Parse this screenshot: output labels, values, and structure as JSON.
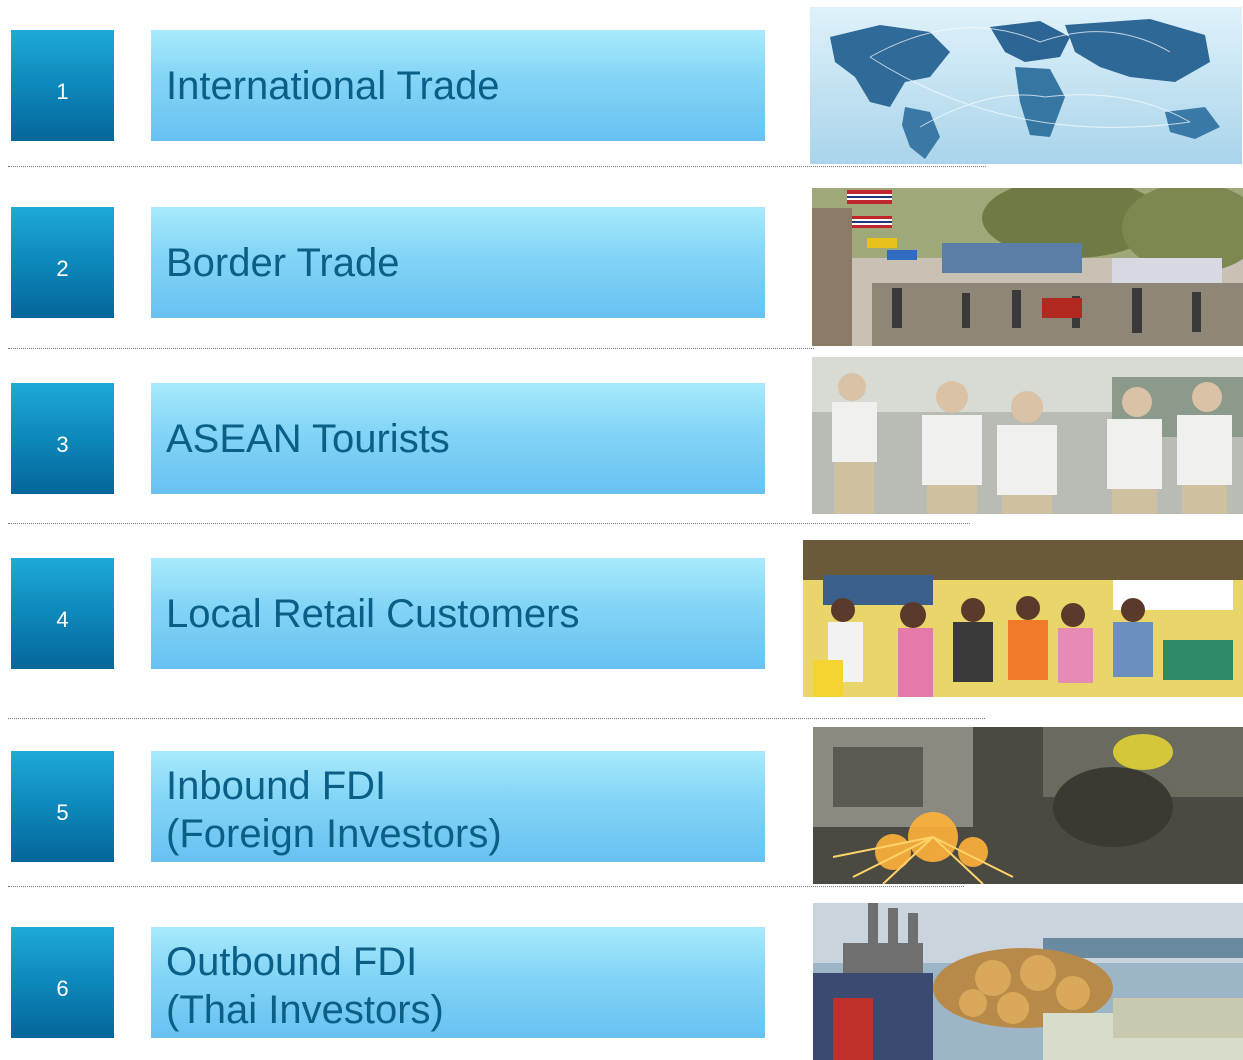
{
  "items": [
    {
      "number": "1",
      "label": "International Trade",
      "image": "world-map-network-photo"
    },
    {
      "number": "2",
      "label": "Border Trade",
      "image": "border-checkpoint-photo"
    },
    {
      "number": "3",
      "label": "ASEAN Tourists",
      "image": "tourists-walking-photo"
    },
    {
      "number": "4",
      "label": "Local Retail Customers",
      "image": "bank-branch-customers-photo"
    },
    {
      "number": "5",
      "label": "Inbound FDI\n(Foreign Investors)",
      "image": "factory-grinding-sparks-photo"
    },
    {
      "number": "6",
      "label": "Outbound FDI\n(Thai Investors)",
      "image": "industry-coins-banknotes-photo"
    }
  ],
  "colors": {
    "number_box": "#0c84b8",
    "label_box": "#86d6f7",
    "label_text": "#0a5f86",
    "separator": "#7a7a7a"
  }
}
